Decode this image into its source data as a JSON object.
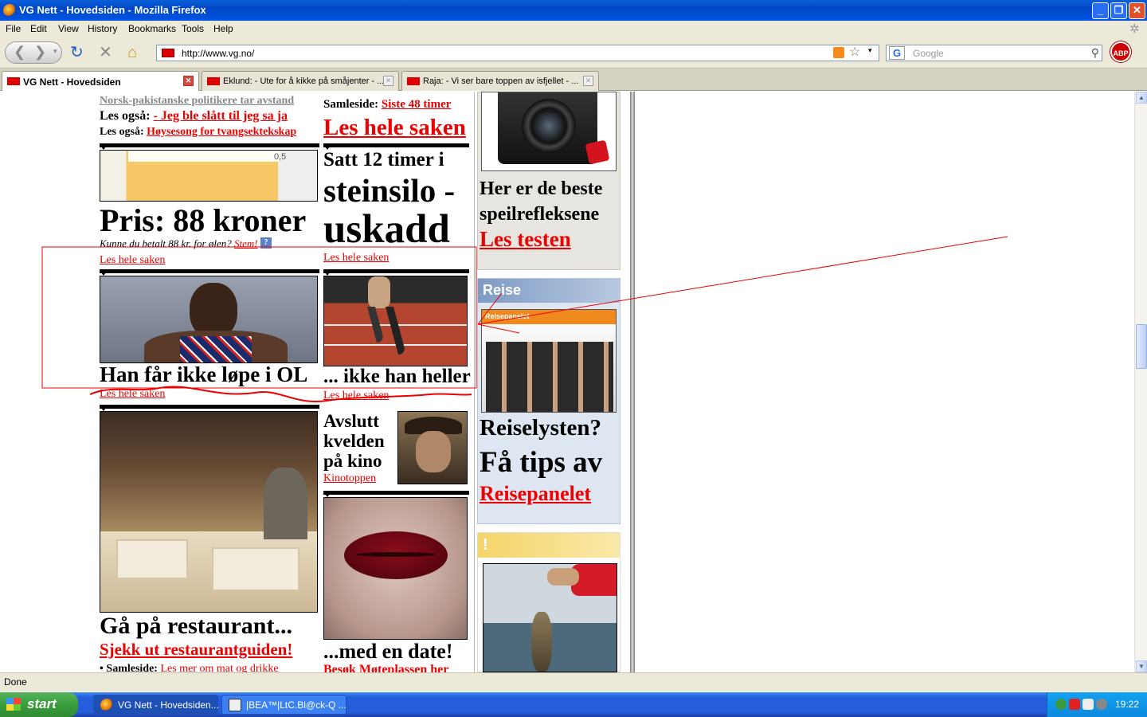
{
  "window": {
    "title": "VG Nett - Hovedsiden - Mozilla Firefox",
    "min": "_",
    "max": "❐",
    "close": "✕"
  },
  "menu": [
    "File",
    "Edit",
    "View",
    "History",
    "Bookmarks",
    "Tools",
    "Help"
  ],
  "nav": {
    "url": "http://www.vg.no/",
    "search_placeholder": "Google",
    "search_engine": "G",
    "abp": "ABP"
  },
  "tabs": [
    {
      "label": "VG Nett - Hovedsiden",
      "active": true
    },
    {
      "label": "Eklund: - Ute for å kikke på småjenter - ...",
      "active": false
    },
    {
      "label": "Raja: - Vi ser bare toppen av isfjellet - ...",
      "active": false
    }
  ],
  "page": {
    "top_left": {
      "subhead": "Norsk-pakistanske politikere tar avstand",
      "also1_label": "Les også:",
      "also1_link": "- Jeg ble slått til jeg sa ja",
      "also2_label": "Les også:",
      "also2_link": "Høysesong for tvangsektekskap"
    },
    "top_mid": {
      "samleside_label": "Samleside:",
      "samleside_link": "Siste 48 timer",
      "link": "Les hele saken"
    },
    "beer": {
      "headline": "Pris: 88 kroner",
      "question": "Kunne du betalt 88 kr. for ølen?",
      "vote": "Stem!",
      "link": "Les hele saken",
      "glass_mark": "0,5"
    },
    "silo": {
      "line1": "Satt 12 timer i",
      "line2": "steinsilo -",
      "line3": "uskadd",
      "link": "Les hele saken"
    },
    "ol": {
      "headline": "Han får ikke løpe i OL",
      "link": "Les hele saken"
    },
    "heller": {
      "headline": "... ikke han heller",
      "link": "Les hele saken"
    },
    "restaurant": {
      "headline": "Gå på restaurant...",
      "link": "Sjekk ut restaurantguiden!",
      "samleside_label": "Samleside:",
      "samleside_link": "Les mer om  mat og drikke"
    },
    "kino": {
      "headline_lines": [
        "Avslutt",
        "kvelden",
        "på kino"
      ],
      "link": "Kinotoppen"
    },
    "date": {
      "headline": "...med en date!",
      "link": "Besøk Møteplassen her"
    },
    "sidebar": {
      "camera_headline_lines": [
        "Her er de beste",
        "speilrefleksene"
      ],
      "camera_link": "Les testen",
      "reise_header": "Reise",
      "reise_img_label": "Reisepanelet",
      "reise_q": "Reiselysten?",
      "reise_tips": "Få tips av",
      "reise_link": "Reisepanelet",
      "bang_header": "!"
    }
  },
  "status": "Done",
  "taskbar": {
    "start": "start",
    "buttons": [
      {
        "label": "VG Nett - Hovedsiden...",
        "active": true
      },
      {
        "label": "|BEA™|LtC.Bl@ck-Q ...",
        "active": false
      }
    ],
    "clock": "19:22"
  }
}
